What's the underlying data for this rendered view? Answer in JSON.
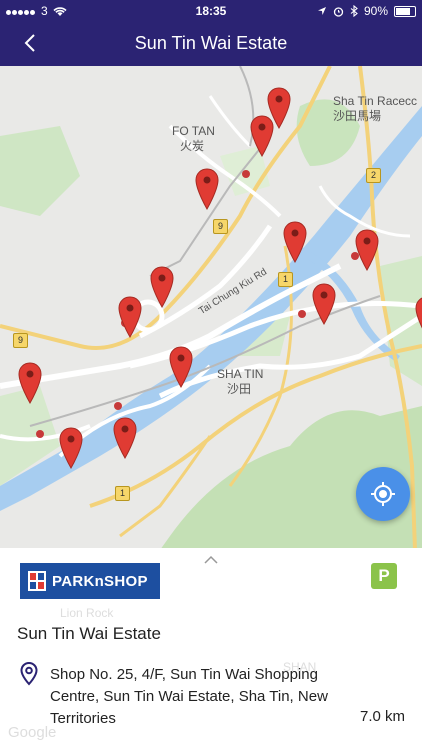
{
  "status_bar": {
    "carrier": "3",
    "time": "18:35",
    "battery": "90%",
    "battery_level": 0.9
  },
  "navbar": {
    "title": "Sun Tin Wai Estate",
    "back_icon": "chevron-left-icon"
  },
  "map": {
    "labels": {
      "fo_tan": "FO TAN",
      "fo_tan_zh": "火炭",
      "racecourse": "Sha Tin Racecc",
      "racecourse_zh": "沙田馬場",
      "sha_tin": "SHA TIN",
      "sha_tin_zh": "沙田",
      "road": "Tai Chung Kiu Rd",
      "route_9a": "9",
      "route_9b": "9",
      "route_2": "2",
      "route_1a": "1",
      "route_1b": "1"
    },
    "pin_count": 15,
    "pin_color": "#e03b33",
    "locate_icon": "crosshair-icon"
  },
  "store": {
    "brand": "PARKnSHOP",
    "brand_color": "#1d4fa0",
    "parking_label": "P",
    "parking_color": "#8bc34a",
    "name": "Sun Tin Wai Estate",
    "address": "Shop No. 25, 4/F, Sun Tin Wai Shopping Centre, Sun Tin Wai Estate, Sha Tin, New Territories",
    "distance": "7.0 km"
  },
  "watermarks": {
    "lion_rock": "Lion Rock",
    "google": "Google",
    "shan": "SHAN"
  }
}
